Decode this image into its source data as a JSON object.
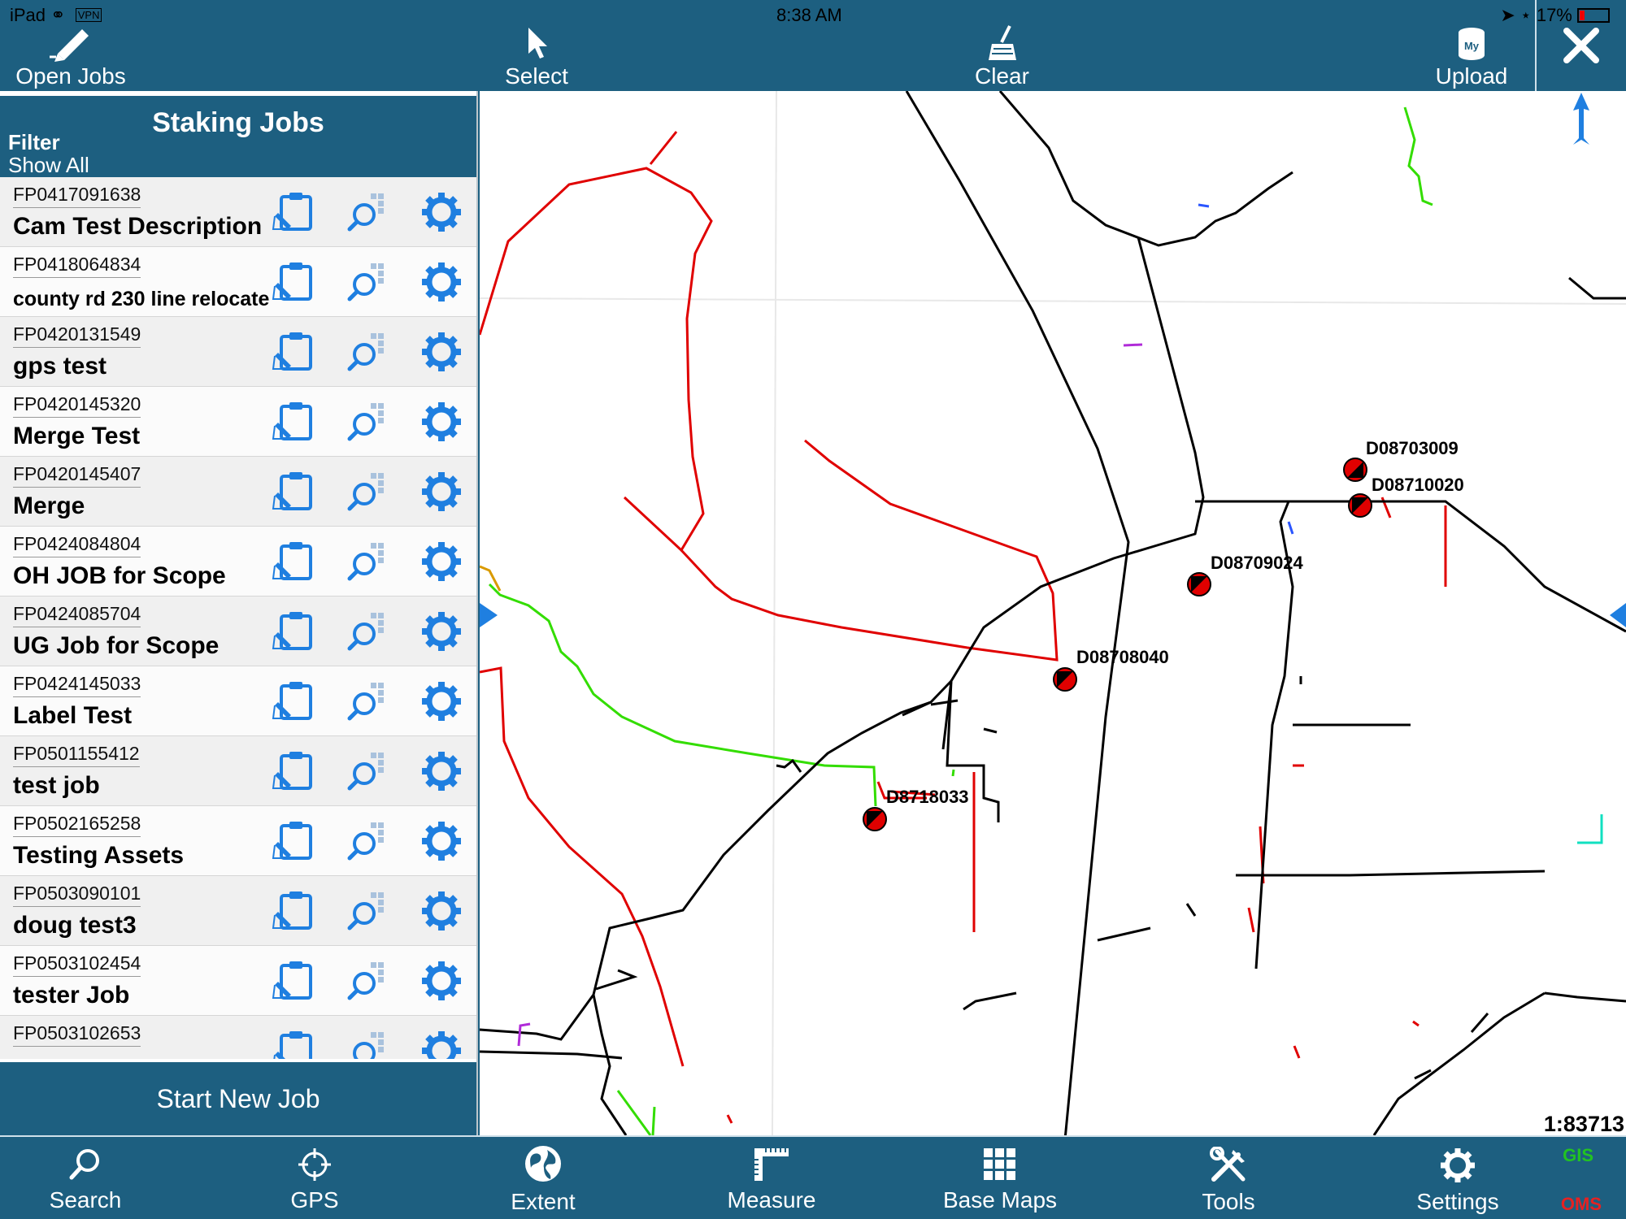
{
  "status": {
    "device": "iPad",
    "vpn": "VPN",
    "time": "8:38 AM",
    "battery": "17%"
  },
  "toolbar": {
    "open_jobs": "Open Jobs",
    "select": "Select",
    "clear": "Clear",
    "upload": "Upload",
    "upload_badge": "My"
  },
  "sidebar": {
    "title": "Staking Jobs",
    "filter_label": "Filter",
    "filter_value": "Show All",
    "jobs": [
      {
        "id": "FP0417091638",
        "name": "Cam Test Description"
      },
      {
        "id": "FP0418064834",
        "name": "county rd 230 line relocate"
      },
      {
        "id": "FP0420131549",
        "name": "gps test"
      },
      {
        "id": "FP0420145320",
        "name": "Merge Test"
      },
      {
        "id": "FP0420145407",
        "name": "Merge"
      },
      {
        "id": "FP0424084804",
        "name": "OH JOB for Scope"
      },
      {
        "id": "FP0424085704",
        "name": "UG Job for Scope"
      },
      {
        "id": "FP0424145033",
        "name": "Label Test"
      },
      {
        "id": "FP0501155412",
        "name": "test job"
      },
      {
        "id": "FP0502165258",
        "name": "Testing Assets"
      },
      {
        "id": "FP0503090101",
        "name": "doug test3"
      },
      {
        "id": "FP0503102454",
        "name": "tester Job"
      },
      {
        "id": "FP0503102653",
        "name": ""
      }
    ],
    "start_new_job": "Start New Job"
  },
  "map": {
    "scale": "1:83713",
    "labels": [
      "D08703009",
      "D08710020",
      "D08709024",
      "D08708040",
      "D8718033"
    ]
  },
  "bottombar": {
    "search": "Search",
    "gps": "GPS",
    "extent": "Extent",
    "measure": "Measure",
    "base_maps": "Base Maps",
    "tools": "Tools",
    "settings": "Settings",
    "gis": "GIS",
    "oms": "OMS"
  },
  "colors": {
    "brand": "#1d5f80",
    "icon_blue": "#1f7fe0",
    "primary_line": "#e00000",
    "secondary_line": "#000000",
    "service_line": "#33dd00"
  }
}
